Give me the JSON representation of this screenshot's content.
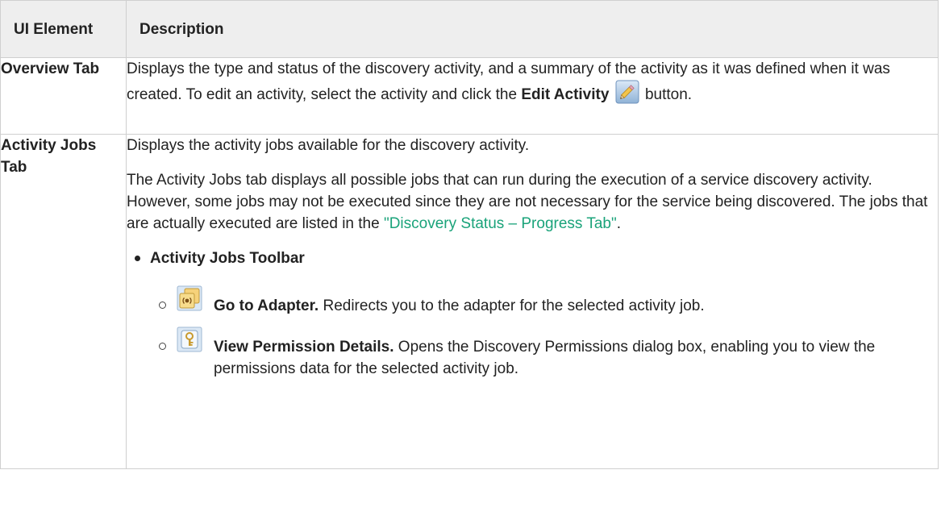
{
  "table": {
    "headers": [
      "UI Element",
      "Description"
    ],
    "overview": {
      "label": "Overview Tab",
      "line1": "Displays the type and status of the discovery activity, and a summary of the activity as it was defined when it was created. To edit an activity, select the activity and click the ",
      "bold": "Edit Activity",
      "icon": "pencil-edit-icon",
      "after": " button."
    },
    "jobs": {
      "label": "Activity Jobs Tab",
      "p1": "Displays the activity jobs available for the discovery activity.",
      "p2_text": "The Activity Jobs tab displays all possible jobs that can run during the execution of a service discovery activity. However, some jobs may not be executed since they are not necessary for the service being discovered. The jobs that are actually executed are listed in the ",
      "p2_link": "\"Discovery Status – Progress Tab\"",
      "p2_end": ".",
      "toolbar_title": "Activity Jobs Toolbar",
      "items": [
        {
          "icon": "go-to-adapter-icon",
          "bold": "Go to Adapter.",
          "text": " Redirects you to the adapter for the selected activity job."
        },
        {
          "icon": "view-permission-details-icon",
          "bold": "View Permission Details.",
          "text": " Opens the Discovery Permissions dialog box, enabling you to view the permissions data for the selected activity job."
        }
      ]
    }
  },
  "colors": {
    "header_bg": "#eeeeee",
    "border": "#cfcfcf",
    "link": "#1aa37a"
  }
}
